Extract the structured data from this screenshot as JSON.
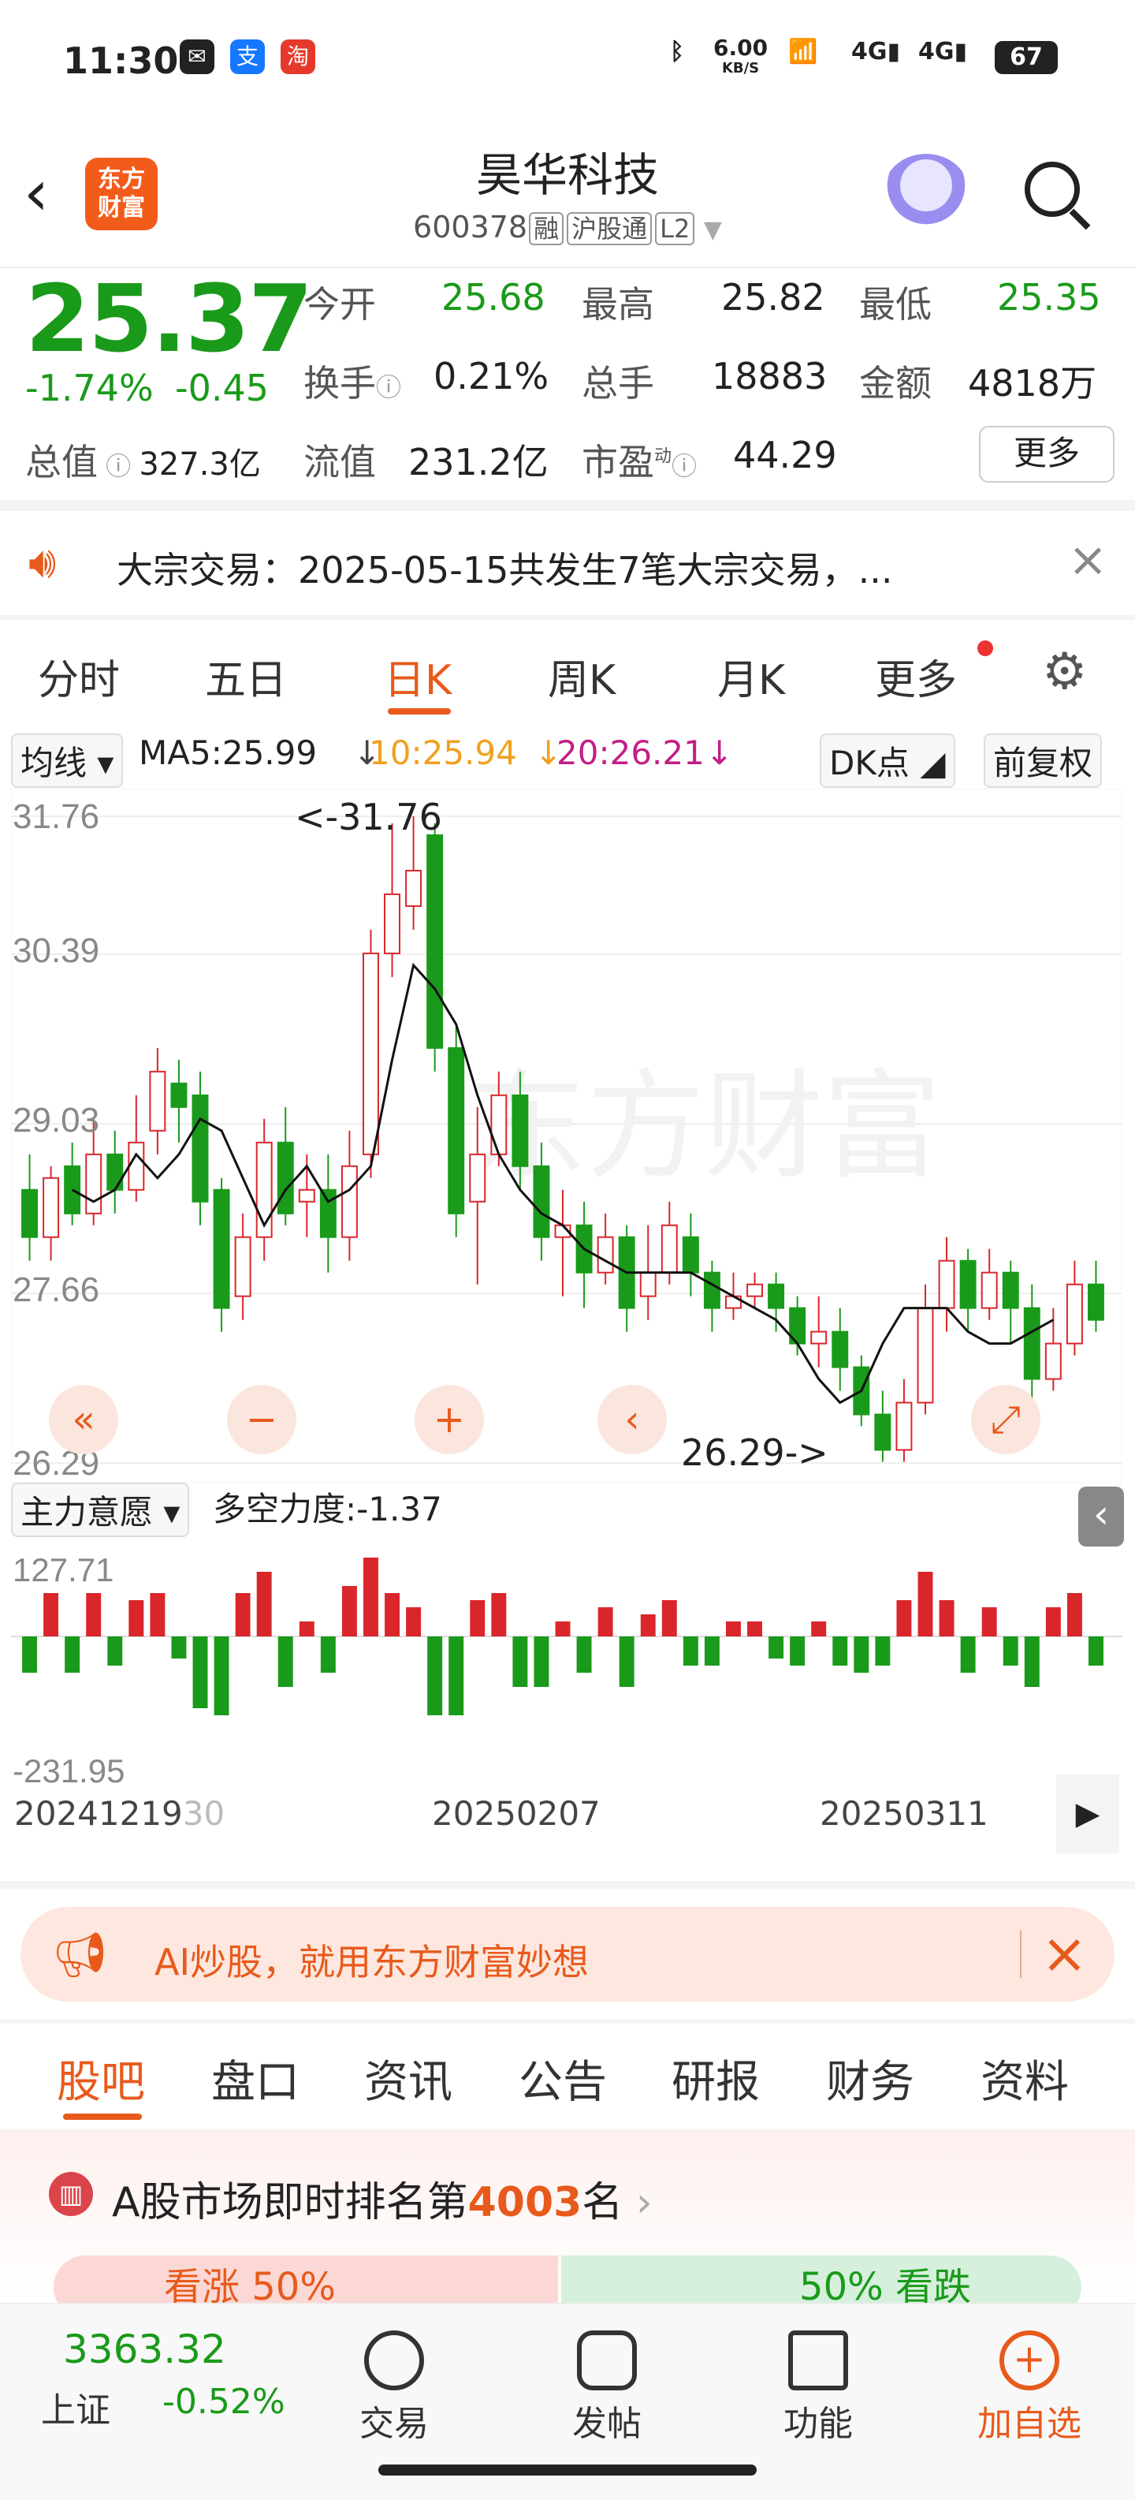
{
  "status": {
    "time": "11:30",
    "net_speed": "6.00",
    "net_unit": "KB/S",
    "battery": "67"
  },
  "header": {
    "title": "昊华科技",
    "code": "600378",
    "tags": [
      "融",
      "沪股通",
      "L2"
    ],
    "logo_line1": "东方",
    "logo_line2": "财富"
  },
  "quote": {
    "price": "25.37",
    "change_pct": "-1.74%",
    "change": "-0.45",
    "open_label": "今开",
    "open": "25.68",
    "high_label": "最高",
    "high": "25.82",
    "low_label": "最低",
    "low": "25.35",
    "turnover_label": "换手",
    "turnover": "0.21%",
    "vol_label": "总手",
    "vol": "18883",
    "amount_label": "金额",
    "amount": "4818万",
    "mktcap_label": "总值",
    "mktcap": "327.3亿",
    "float_label": "流值",
    "float": "231.2亿",
    "pe_label": "市盈",
    "pe_sup": "动",
    "pe": "44.29",
    "more": "更多"
  },
  "notice": {
    "text": "大宗交易：2025-05-15共发生7笔大宗交易，..."
  },
  "chart_tabs": [
    "分时",
    "五日",
    "日K",
    "周K",
    "月K",
    "更多"
  ],
  "toolbar": {
    "ma_select": "均线",
    "ma5": "MA5:25.99",
    "ma10": "10:25.94",
    "ma20": "20:26.21",
    "dk": "DK点",
    "adjust": "前复权"
  },
  "chart": {
    "y_top": "31.76",
    "y2": "30.39",
    "y3": "29.03",
    "y4": "27.66",
    "y_bottom": "26.29",
    "max_label": "<-31.76",
    "min_label": "26.29->"
  },
  "indicator": {
    "select": "主力意愿",
    "label": "多空力度:-1.37",
    "top": "127.71",
    "bottom": "-231.95"
  },
  "dates": {
    "d1": "20241219",
    "d1b": "30",
    "d2": "20250207",
    "d3": "20250311"
  },
  "ai_banner": {
    "text": "AI炒股，就用东方财富妙想"
  },
  "info_tabs": [
    "股吧",
    "盘口",
    "资讯",
    "公告",
    "研报",
    "财务",
    "资料"
  ],
  "rank": {
    "prefix": "A股市场即时排名第",
    "num": "4003",
    "suffix": "名",
    "rise": "看涨 50%",
    "fall": "50% 看跌"
  },
  "bottom": {
    "index_value": "3363.32",
    "index_name": "上证",
    "index_chg": "-0.52%",
    "trade": "交易",
    "post": "发帖",
    "func": "功能",
    "add": "加自选"
  },
  "colors": {
    "red": "#d9262b",
    "green": "#1a9a1a",
    "accent": "#e85a1b"
  },
  "chart_data": {
    "type": "candlestick",
    "ylim": [
      26.29,
      31.76
    ],
    "candles": [
      [
        28.6,
        28.2,
        28.9,
        28.0
      ],
      [
        28.2,
        28.7,
        28.8,
        28.0
      ],
      [
        28.8,
        28.4,
        29.0,
        28.3
      ],
      [
        28.4,
        28.9,
        29.2,
        28.3
      ],
      [
        28.9,
        28.6,
        29.1,
        28.4
      ],
      [
        28.6,
        29.0,
        29.4,
        28.5
      ],
      [
        29.1,
        29.6,
        29.8,
        28.9
      ],
      [
        29.5,
        29.3,
        29.7,
        29.0
      ],
      [
        29.4,
        28.5,
        29.6,
        28.3
      ],
      [
        28.6,
        27.6,
        28.7,
        27.4
      ],
      [
        27.7,
        28.2,
        28.4,
        27.5
      ],
      [
        28.2,
        29.0,
        29.2,
        28.0
      ],
      [
        29.0,
        28.4,
        29.3,
        28.3
      ],
      [
        28.5,
        28.6,
        28.9,
        28.2
      ],
      [
        28.6,
        28.2,
        28.9,
        27.9
      ],
      [
        28.2,
        28.8,
        29.1,
        28.0
      ],
      [
        28.9,
        30.6,
        30.8,
        28.7
      ],
      [
        30.6,
        31.1,
        31.7,
        30.4
      ],
      [
        31.0,
        31.3,
        31.76,
        30.8
      ],
      [
        31.6,
        29.8,
        31.7,
        29.6
      ],
      [
        29.8,
        28.4,
        30.0,
        28.2
      ],
      [
        28.5,
        28.9,
        29.3,
        27.8
      ],
      [
        28.9,
        29.4,
        29.6,
        28.8
      ],
      [
        29.4,
        28.8,
        29.6,
        28.6
      ],
      [
        28.8,
        28.2,
        29.0,
        28.0
      ],
      [
        28.2,
        28.3,
        28.6,
        27.7
      ],
      [
        28.3,
        27.9,
        28.5,
        27.6
      ],
      [
        27.9,
        28.2,
        28.4,
        27.8
      ],
      [
        28.2,
        27.6,
        28.3,
        27.4
      ],
      [
        27.7,
        27.9,
        28.3,
        27.5
      ],
      [
        27.9,
        28.3,
        28.5,
        27.8
      ],
      [
        28.2,
        27.9,
        28.4,
        27.7
      ],
      [
        27.9,
        27.6,
        28.0,
        27.4
      ],
      [
        27.6,
        27.7,
        27.9,
        27.5
      ],
      [
        27.7,
        27.8,
        27.9,
        27.6
      ],
      [
        27.8,
        27.6,
        27.9,
        27.4
      ],
      [
        27.6,
        27.3,
        27.7,
        27.2
      ],
      [
        27.3,
        27.4,
        27.7,
        27.1
      ],
      [
        27.4,
        27.1,
        27.6,
        26.9
      ],
      [
        27.1,
        26.7,
        27.2,
        26.6
      ],
      [
        26.7,
        26.4,
        26.9,
        26.3
      ],
      [
        26.4,
        26.8,
        27.0,
        26.3
      ],
      [
        26.8,
        27.6,
        27.8,
        26.7
      ],
      [
        27.6,
        28.0,
        28.2,
        27.4
      ],
      [
        28.0,
        27.6,
        28.1,
        27.4
      ],
      [
        27.6,
        27.9,
        28.1,
        27.5
      ],
      [
        27.9,
        27.6,
        28.0,
        27.3
      ],
      [
        27.6,
        27.0,
        27.8,
        26.8
      ],
      [
        27.0,
        27.3,
        27.6,
        26.9
      ],
      [
        27.3,
        27.8,
        28.0,
        27.2
      ],
      [
        27.8,
        27.5,
        28.0,
        27.4
      ]
    ],
    "ma5": [
      28.6,
      28.5,
      28.6,
      28.9,
      28.7,
      28.9,
      29.2,
      29.1,
      28.7,
      28.3,
      28.6,
      28.8,
      28.5,
      28.6,
      28.8,
      29.7,
      30.5,
      30.3,
      30.0,
      29.4,
      28.9,
      28.6,
      28.4,
      28.3,
      28.1,
      28.0,
      27.9,
      27.9,
      27.9,
      27.9,
      27.8,
      27.7,
      27.6,
      27.5,
      27.3,
      27.0,
      26.8,
      26.9,
      27.3,
      27.6,
      27.6,
      27.6,
      27.4,
      27.3,
      27.3,
      27.4,
      27.5
    ]
  }
}
